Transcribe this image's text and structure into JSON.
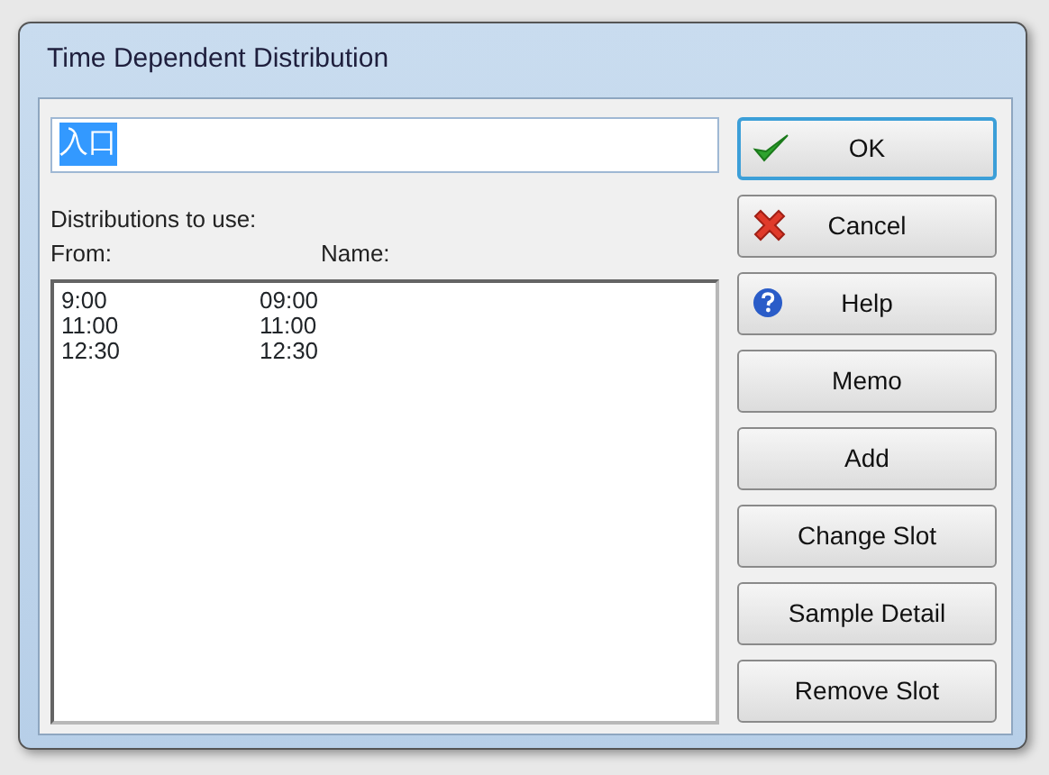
{
  "window": {
    "title": "Time Dependent Distribution"
  },
  "name_field": {
    "value": "入口",
    "selected": true
  },
  "list_label": "Distributions to use:",
  "columns": [
    "From:",
    "Name:"
  ],
  "rows": [
    {
      "from": "9:00",
      "name": "09:00"
    },
    {
      "from": "11:00",
      "name": "11:00"
    },
    {
      "from": "12:30",
      "name": "12:30"
    }
  ],
  "buttons": [
    {
      "label": "OK",
      "kind": "ok",
      "default": true
    },
    {
      "label": "Cancel",
      "kind": "cancel",
      "default": false
    },
    {
      "label": "Help",
      "kind": "help",
      "default": false
    },
    {
      "label": "Memo",
      "kind": "plain",
      "default": false
    },
    {
      "label": "Add",
      "kind": "plain",
      "default": false
    },
    {
      "label": "Change Slot",
      "kind": "plain",
      "default": false
    },
    {
      "label": "Sample Detail",
      "kind": "plain",
      "default": false
    },
    {
      "label": "Remove Slot",
      "kind": "plain",
      "default": false
    }
  ]
}
